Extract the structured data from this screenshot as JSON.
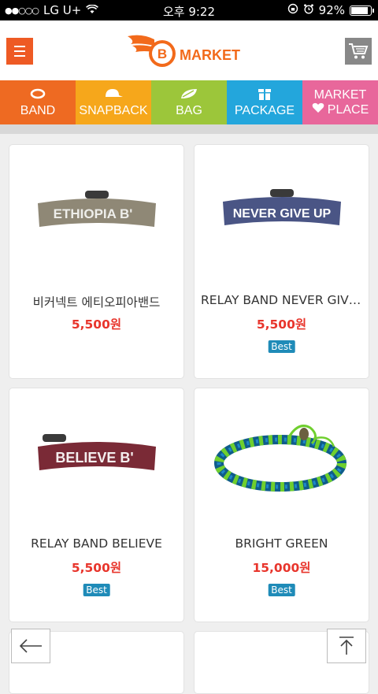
{
  "statusbar": {
    "carrier": "LG U+",
    "time": "오후 9:22",
    "battery": "92%",
    "battery_level": 0.92
  },
  "header": {
    "logo_letter": "B",
    "logo_text": "MARKET"
  },
  "categories": [
    {
      "label": "BAND",
      "icon": "band-icon"
    },
    {
      "label": "SNAPBACK",
      "icon": "cap-icon"
    },
    {
      "label": "BAG",
      "icon": "leaf-icon"
    },
    {
      "label": "PACKAGE",
      "icon": "gift-icon"
    },
    {
      "label1": "MARKET",
      "label2": "PLACE",
      "icon": "heart-icon"
    }
  ],
  "products": [
    {
      "name": "비커넥트 에티오피아밴드",
      "price": "5,500원",
      "band_text": "ETHIOPIA B'",
      "band_color": "#8f8876"
    },
    {
      "name": "RELAY BAND NEVER GIVE UP",
      "price": "5,500원",
      "badge": "Best",
      "band_text": "NEVER GIVE UP",
      "band_color": "#4a5585"
    },
    {
      "name": "RELAY BAND BELIEVE",
      "price": "5,500원",
      "badge": "Best",
      "band_text": "BELIEVE B'",
      "band_color": "#7a2a36"
    },
    {
      "name": "BRIGHT GREEN",
      "price": "15,000원",
      "badge": "Best"
    }
  ]
}
